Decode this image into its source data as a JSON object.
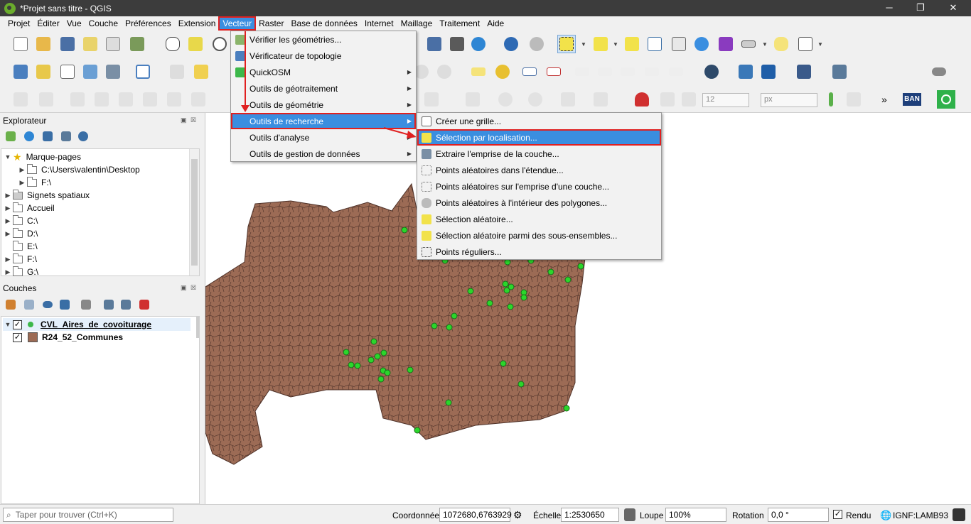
{
  "window": {
    "title": "*Projet sans titre - QGIS",
    "minimize": "─",
    "maximize": "❐",
    "close": "✕"
  },
  "menubar": [
    "Projet",
    "Éditer",
    "Vue",
    "Couche",
    "Préférences",
    "Extension",
    "Vecteur",
    "Raster",
    "Base de données",
    "Internet",
    "Maillage",
    "Traitement",
    "Aide"
  ],
  "menubar_active": "Vecteur",
  "vector_menu": [
    {
      "label": "Vérifier les géométries...",
      "submenu": false
    },
    {
      "label": "Vérificateur de topologie",
      "submenu": false
    },
    {
      "label": "QuickOSM",
      "submenu": true
    },
    {
      "label": "Outils de géotraitement",
      "submenu": true
    },
    {
      "label": "Outils de géométrie",
      "submenu": true
    },
    {
      "label": "Outils de recherche",
      "submenu": true,
      "highlighted": true
    },
    {
      "label": "Outils d'analyse",
      "submenu": true
    },
    {
      "label": "Outils de gestion de données",
      "submenu": true
    }
  ],
  "research_submenu": [
    {
      "label": "Créer une grille...",
      "icon": "grid-icon"
    },
    {
      "label": "Sélection par localisation...",
      "icon": "select-location-icon",
      "highlighted": true
    },
    {
      "label": "Extraire l'emprise de la couche...",
      "icon": "extent-icon"
    },
    {
      "label": "Points aléatoires dans l'étendue...",
      "icon": "random-points-icon"
    },
    {
      "label": "Points aléatoires sur l'emprise d'une couche...",
      "icon": "random-points-icon"
    },
    {
      "label": "Points aléatoires à l'intérieur des polygones...",
      "icon": "random-points-polygon-icon"
    },
    {
      "label": "Sélection aléatoire...",
      "icon": "random-select-icon"
    },
    {
      "label": "Sélection aléatoire parmi des sous-ensembles...",
      "icon": "random-select-icon"
    },
    {
      "label": "Points réguliers...",
      "icon": "regular-points-icon"
    }
  ],
  "toolbar": {
    "size_value": "12",
    "unit_value": "px",
    "more": "»",
    "ban": "BAN"
  },
  "explorer": {
    "title": "Explorateur",
    "items": [
      {
        "label": "Marque-pages",
        "expanded": true,
        "icon": "star-icon"
      },
      {
        "label": "C:\\Users\\valentin\\Desktop",
        "child": true
      },
      {
        "label": "F:\\",
        "child": true
      },
      {
        "label": "Signets spatiaux",
        "icon": "bookmark-icon"
      },
      {
        "label": "Accueil",
        "icon": "home-folder-icon"
      },
      {
        "label": "C:\\",
        "icon": "folder-icon"
      },
      {
        "label": "D:\\",
        "icon": "folder-icon"
      },
      {
        "label": "E:\\",
        "icon": "folder-icon",
        "no_arrow": true
      },
      {
        "label": "F:\\",
        "icon": "folder-icon"
      },
      {
        "label": "G:\\",
        "icon": "folder-icon"
      }
    ]
  },
  "layers": {
    "title": "Couches",
    "items": [
      {
        "label": "CVL_Aires_de_covoiturage",
        "checked": true,
        "symbol": "point",
        "color": "#3cb84a",
        "bold": true
      },
      {
        "label": "R24_52_Communes",
        "checked": true,
        "symbol": "polygon",
        "color": "#9c6b55",
        "bold": false
      }
    ]
  },
  "statusbar": {
    "search_placeholder": "Taper pour trouver (Ctrl+K)",
    "coord_label": "Coordonnée",
    "coord_value": "1072680,6763929",
    "scale_label": "Échelle",
    "scale_value": "1:2530650",
    "zoom_label": "Loupe",
    "zoom_value": "100%",
    "rotation_label": "Rotation",
    "rotation_value": "0,0 °",
    "render_label": "Rendu",
    "render_checked": true,
    "crs": "IGNF:LAMB93"
  },
  "colors": {
    "accent": "#3a8ee0",
    "highlight_box": "#e02020",
    "commune_fill": "#9c6b55",
    "point_fill": "#2bd62b"
  }
}
